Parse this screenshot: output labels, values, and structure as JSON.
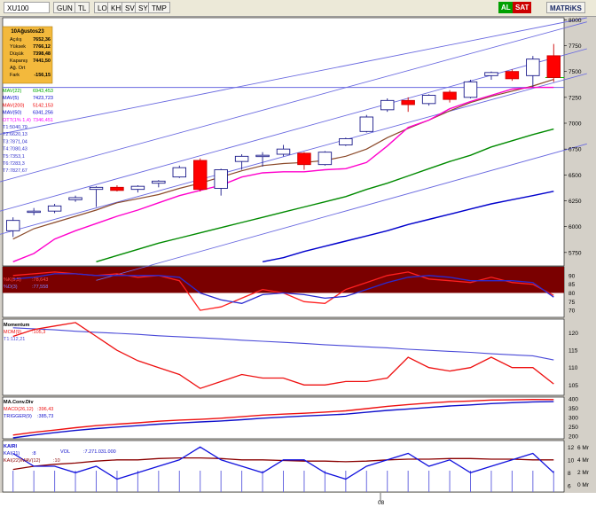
{
  "toolbar": {
    "symbol": "XU100",
    "buttons": [
      "GUN",
      "TL",
      "LOG",
      "KHN",
      "SVD",
      "SYM",
      "TMP"
    ],
    "flags": [
      "AL",
      "SAT"
    ],
    "brand": "MATRiKS"
  },
  "info": {
    "date": "10Ağustos23",
    "rows": [
      {
        "label": "Açılış",
        "value": "7652,36"
      },
      {
        "label": "Yüksek",
        "value": "7766,12"
      },
      {
        "label": "Düşük",
        "value": "7398,48"
      },
      {
        "label": "Kapanış",
        "value": "7441,50"
      },
      {
        "label": "Ağ. Ort",
        "value": ""
      },
      {
        "label": "Fark",
        "value": "-156,15"
      }
    ]
  },
  "legend": [
    {
      "label": "MAV(22)",
      "value": "6943,453",
      "color": "#00aa00"
    },
    {
      "label": "MAV(5)",
      "value": "7423,723",
      "color": "#0000cc"
    },
    {
      "label": "MAV(200)",
      "value": "5142,153",
      "color": "#ee0000"
    },
    {
      "label": "MAV(50)",
      "value": "6341,256",
      "color": "#0000cc"
    },
    {
      "label": "OTT(1% 1,4)",
      "value": "7346,451",
      "color": "#ff00ff"
    },
    {
      "label": "T1:5040,79",
      "value": "",
      "color": "#3333cc"
    },
    {
      "label": "T2:6620,13",
      "value": "",
      "color": "#3333cc"
    },
    {
      "label": "T3:7871,04",
      "value": "",
      "color": "#3333cc"
    },
    {
      "label": "T4:7080,43",
      "value": "",
      "color": "#3333cc"
    },
    {
      "label": "T5:7353,1",
      "value": "",
      "color": "#3333cc"
    },
    {
      "label": "T6:7283,3",
      "value": "",
      "color": "#3333cc"
    },
    {
      "label": "T7:7827,67",
      "value": "",
      "color": "#3333cc"
    }
  ],
  "panels": {
    "stoch": {
      "k_label": "%K(5,5)",
      "k_value": ":78,643",
      "d_label": "%D(3)",
      "d_value": ":77,558"
    },
    "momentum": {
      "title": "Momentum",
      "mom_label": "MOM(9)",
      "mom_value": ":105,3",
      "t_label": "T1:112,21"
    },
    "macd": {
      "title": "MA.Conv.Div",
      "macd_label": "MACD(26,12)",
      "macd_value": ":396,43",
      "trig_label": "TRIGGER(9)",
      "trig_value": ":385,73"
    },
    "kairi": {
      "title": "KAIRI",
      "k1_label": "KAI(11)",
      "k1_value": ":8",
      "k2_label": "KAI(22)/MAV(12)",
      "k2_value": ":10",
      "vol_label": "VOL",
      "vol_value": ":7.271.031.000"
    }
  },
  "x_axis_label": "08",
  "chart_data": [
    {
      "type": "candlestick",
      "title": "XU100",
      "y_ticks": [
        5750,
        6000,
        6250,
        6500,
        6750,
        7000,
        7250,
        7500,
        7750,
        8000
      ],
      "ylim": [
        5620,
        8020
      ],
      "candles": [
        {
          "o": 5960,
          "h": 6090,
          "l": 5900,
          "c": 6060
        },
        {
          "o": 6140,
          "h": 6180,
          "l": 6110,
          "c": 6150
        },
        {
          "o": 6150,
          "h": 6220,
          "l": 6130,
          "c": 6200
        },
        {
          "o": 6260,
          "h": 6300,
          "l": 6240,
          "c": 6280
        },
        {
          "o": 6360,
          "h": 6390,
          "l": 6190,
          "c": 6380
        },
        {
          "o": 6380,
          "h": 6400,
          "l": 6340,
          "c": 6350
        },
        {
          "o": 6360,
          "h": 6400,
          "l": 6330,
          "c": 6390
        },
        {
          "o": 6420,
          "h": 6450,
          "l": 6380,
          "c": 6440
        },
        {
          "o": 6480,
          "h": 6590,
          "l": 6470,
          "c": 6570
        },
        {
          "o": 6640,
          "h": 6660,
          "l": 6340,
          "c": 6360
        },
        {
          "o": 6370,
          "h": 6560,
          "l": 6300,
          "c": 6550
        },
        {
          "o": 6630,
          "h": 6700,
          "l": 6550,
          "c": 6680
        },
        {
          "o": 6680,
          "h": 6720,
          "l": 6580,
          "c": 6690
        },
        {
          "o": 6700,
          "h": 6790,
          "l": 6680,
          "c": 6750
        },
        {
          "o": 6710,
          "h": 6720,
          "l": 6550,
          "c": 6600
        },
        {
          "o": 6600,
          "h": 6730,
          "l": 6590,
          "c": 6720
        },
        {
          "o": 6790,
          "h": 6860,
          "l": 6780,
          "c": 6850
        },
        {
          "o": 6920,
          "h": 7080,
          "l": 6910,
          "c": 7060
        },
        {
          "o": 7130,
          "h": 7240,
          "l": 7110,
          "c": 7220
        },
        {
          "o": 7220,
          "h": 7250,
          "l": 7110,
          "c": 7180
        },
        {
          "o": 7190,
          "h": 7280,
          "l": 7170,
          "c": 7270
        },
        {
          "o": 7300,
          "h": 7320,
          "l": 7200,
          "c": 7230
        },
        {
          "o": 7250,
          "h": 7420,
          "l": 7240,
          "c": 7400
        },
        {
          "o": 7460,
          "h": 7500,
          "l": 7420,
          "c": 7490
        },
        {
          "o": 7500,
          "h": 7520,
          "l": 7410,
          "c": 7430
        },
        {
          "o": 7460,
          "h": 7650,
          "l": 7350,
          "c": 7620
        },
        {
          "o": 7652.36,
          "h": 7766.12,
          "l": 7398.48,
          "c": 7441.5
        }
      ],
      "series": [
        {
          "name": "MAV(5)",
          "values": [
            5880,
            5980,
            6040,
            6100,
            6160,
            6230,
            6270,
            6310,
            6370,
            6420,
            6480,
            6540,
            6590,
            6610,
            6620,
            6640,
            6680,
            6750,
            6860,
            6950,
            7030,
            7120,
            7200,
            7260,
            7310,
            7360,
            7423.7
          ]
        },
        {
          "name": "OTT(1% 1,4)",
          "values": [
            5660,
            5740,
            5880,
            5960,
            6030,
            6100,
            6160,
            6230,
            6300,
            6350,
            6400,
            6480,
            6520,
            6530,
            6530,
            6550,
            6560,
            6620,
            6780,
            6960,
            7030,
            7140,
            7210,
            7270,
            7330,
            7346,
            7346.5
          ]
        },
        {
          "name": "MAV(22)",
          "values": [
            null,
            null,
            null,
            null,
            5660,
            5720,
            5780,
            5840,
            5890,
            5940,
            5990,
            6040,
            6090,
            6140,
            6190,
            6240,
            6290,
            6360,
            6420,
            6490,
            6560,
            6630,
            6690,
            6770,
            6830,
            6890,
            6943.5
          ]
        },
        {
          "name": "MAV(50)",
          "values": [
            null,
            null,
            null,
            null,
            null,
            null,
            null,
            null,
            null,
            null,
            null,
            null,
            5660,
            5700,
            5760,
            5810,
            5860,
            5910,
            5960,
            6020,
            6070,
            6120,
            6170,
            6220,
            6260,
            6300,
            6341.3
          ]
        }
      ],
      "annotations": [
        "T1:5040,79",
        "T2:6620,13",
        "T3:7871,04",
        "T4:7080,43",
        "T5:7353,1",
        "T6:7283,3",
        "T7:7827,67"
      ]
    },
    {
      "type": "line",
      "title": "%K(5,5) / %D(3)",
      "y_ticks": [
        70,
        75,
        80,
        85,
        90
      ],
      "ylim": [
        66,
        95
      ],
      "series": [
        {
          "name": "%K(5,5)",
          "values": [
            90,
            91,
            92,
            91,
            90,
            91,
            89,
            90,
            87,
            70,
            72,
            77,
            82,
            80,
            75,
            74,
            82,
            86,
            90,
            92,
            88,
            87,
            86,
            89,
            86,
            85,
            78.6
          ]
        },
        {
          "name": "%D(3)",
          "values": [
            88,
            89,
            91,
            91,
            90,
            90,
            90,
            90,
            89,
            80,
            76,
            74,
            79,
            80,
            79,
            77,
            78,
            82,
            86,
            89,
            90,
            89,
            87,
            87,
            87,
            86,
            77.6
          ]
        }
      ]
    },
    {
      "type": "line",
      "title": "Momentum",
      "y_ticks": [
        105,
        110,
        115,
        120
      ],
      "ylim": [
        102,
        124
      ],
      "series": [
        {
          "name": "MOM(9)",
          "values": [
            119,
            121,
            122,
            123,
            119,
            115,
            112,
            110,
            108,
            104,
            106,
            108,
            107,
            107,
            105,
            105,
            106,
            106,
            107,
            113,
            110,
            109,
            110,
            113,
            110,
            110,
            105.3
          ]
        },
        {
          "name": "T1",
          "values": [
            121.5,
            121.2,
            120.9,
            120.5,
            120.2,
            119.9,
            119.6,
            119.2,
            118.9,
            118.6,
            118.3,
            117.9,
            117.6,
            117.3,
            117,
            116.6,
            116.3,
            116,
            115.7,
            115.3,
            115,
            114.7,
            114.4,
            114,
            113.7,
            113.4,
            112.2
          ]
        }
      ]
    },
    {
      "type": "line",
      "title": "MA.Conv.Div",
      "y_ticks": [
        200,
        250,
        300,
        350,
        400
      ],
      "ylim": [
        185,
        410
      ],
      "series": [
        {
          "name": "MACD(26,12)",
          "values": [
            205,
            220,
            232,
            245,
            256,
            264,
            271,
            280,
            286,
            290,
            296,
            304,
            313,
            318,
            323,
            329,
            336,
            348,
            360,
            370,
            378,
            385,
            389,
            394,
            395,
            397,
            396.4
          ]
        },
        {
          "name": "TRIGGER(9)",
          "values": [
            190,
            205,
            218,
            230,
            240,
            248,
            256,
            264,
            270,
            276,
            281,
            288,
            296,
            302,
            308,
            313,
            318,
            328,
            338,
            346,
            354,
            362,
            368,
            375,
            380,
            384,
            385.7
          ]
        }
      ]
    },
    {
      "type": "line",
      "title": "KAIRI",
      "y_ticks": [
        6,
        8,
        10,
        12
      ],
      "ylim": [
        5,
        13
      ],
      "series": [
        {
          "name": "KAI(11)",
          "values": [
            11,
            9,
            9,
            8,
            9,
            7,
            8,
            9,
            10,
            12,
            10,
            9,
            8,
            10,
            10,
            8,
            7,
            9,
            10,
            11,
            9,
            10,
            8,
            9,
            10,
            11,
            8
          ]
        },
        {
          "name": "KAI(22)/MAV(12)",
          "values": [
            8.5,
            9,
            9.3,
            9.5,
            9.8,
            10,
            10,
            10.2,
            10.3,
            10.3,
            10.2,
            10,
            10,
            9.9,
            9.8,
            9.8,
            9.7,
            9.8,
            10,
            10.1,
            10.1,
            10.2,
            10.2,
            10.1,
            10.1,
            10,
            10
          ]
        }
      ],
      "right_ticks": [
        "6 Mr",
        "4 Mr",
        "2 Mr",
        "0 Mr"
      ]
    }
  ]
}
